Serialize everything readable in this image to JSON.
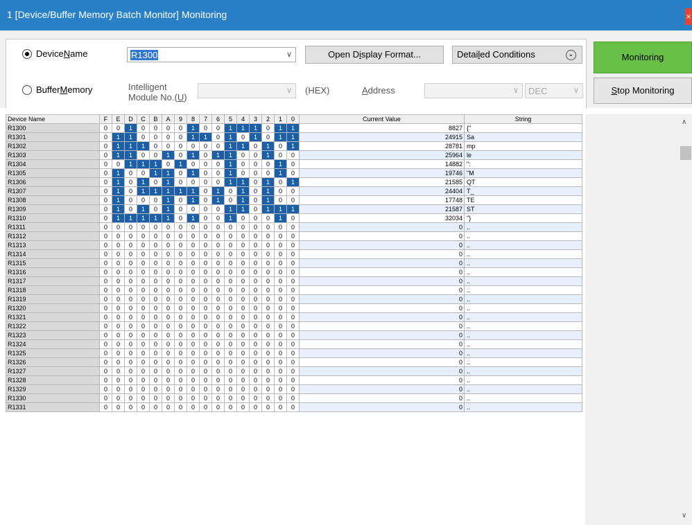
{
  "window": {
    "title": "1 [Device/Buffer Memory Batch Monitor] Monitoring",
    "close_glyph": "×"
  },
  "device": {
    "radio_label_pre": "Device ",
    "radio_label_key": "N",
    "radio_label_post": "ame",
    "value": "R1300",
    "dropdown_glyph": "∨"
  },
  "buffer": {
    "radio_label_pre": "Buffer ",
    "radio_label_key": "M",
    "radio_label_post": "emory",
    "module_label_line1": "Intelligent",
    "module_label_line2_pre": "Module No.(",
    "module_label_line2_key": "U",
    "module_label_line2_post": ")",
    "hex_label": "(HEX)",
    "address_label_key": "A",
    "address_label_post": "ddress",
    "dec_label": "DEC"
  },
  "buttons": {
    "open_display_pre": "Open D",
    "open_display_key": "i",
    "open_display_post": "splay Format...",
    "detailed_pre": "Detai",
    "detailed_key": "l",
    "detailed_post": "ed Conditions",
    "detailed_glyph": "⌄",
    "monitoring": "Monitoring",
    "stop_key": "S",
    "stop_post": "top Monitoring"
  },
  "colors": {
    "title_bar": "#2a80c6",
    "monitoring_button": "#69c049",
    "bit_on": "#1b5fa8"
  },
  "table": {
    "headers": {
      "device": "Device Name",
      "bits": [
        "F",
        "E",
        "D",
        "C",
        "B",
        "A",
        "9",
        "8",
        "7",
        "6",
        "5",
        "4",
        "3",
        "2",
        "1",
        "0"
      ],
      "value": "Current Value",
      "string": "String"
    },
    "rows": [
      {
        "device": "R1300",
        "bits": "0010000100111011",
        "value": "8827",
        "string": "{\""
      },
      {
        "device": "R1301",
        "bits": "0110000110101011",
        "value": "24915",
        "string": "Sa"
      },
      {
        "device": "R1302",
        "bits": "0111000000110101",
        "value": "28781",
        "string": "mp"
      },
      {
        "device": "R1303",
        "bits": "0110010101100100",
        "value": "25964",
        "string": "le"
      },
      {
        "device": "R1304",
        "bits": "0011101000100010",
        "value": "14882",
        "string": "\":"
      },
      {
        "device": "R1305",
        "bits": "0100110100100010",
        "value": "19746",
        "string": "\"M"
      },
      {
        "device": "R1306",
        "bits": "0101010000110101",
        "value": "21585",
        "string": "QT"
      },
      {
        "device": "R1307",
        "bits": "0101111101010100",
        "value": "24404",
        "string": "T_"
      },
      {
        "device": "R1308",
        "bits": "0100010101010100",
        "value": "17748",
        "string": "TE"
      },
      {
        "device": "R1309",
        "bits": "0101010000110111",
        "value": "21587",
        "string": "ST"
      },
      {
        "device": "R1310",
        "bits": "0111110100100010",
        "value": "32034",
        "string": "\"}"
      },
      {
        "device": "R1311",
        "bits": "0000000000000000",
        "value": "0",
        "string": ".."
      },
      {
        "device": "R1312",
        "bits": "0000000000000000",
        "value": "0",
        "string": ".."
      },
      {
        "device": "R1313",
        "bits": "0000000000000000",
        "value": "0",
        "string": ".."
      },
      {
        "device": "R1314",
        "bits": "0000000000000000",
        "value": "0",
        "string": ".."
      },
      {
        "device": "R1315",
        "bits": "0000000000000000",
        "value": "0",
        "string": ".."
      },
      {
        "device": "R1316",
        "bits": "0000000000000000",
        "value": "0",
        "string": ".."
      },
      {
        "device": "R1317",
        "bits": "0000000000000000",
        "value": "0",
        "string": ".."
      },
      {
        "device": "R1318",
        "bits": "0000000000000000",
        "value": "0",
        "string": ".."
      },
      {
        "device": "R1319",
        "bits": "0000000000000000",
        "value": "0",
        "string": ".."
      },
      {
        "device": "R1320",
        "bits": "0000000000000000",
        "value": "0",
        "string": ".."
      },
      {
        "device": "R1321",
        "bits": "0000000000000000",
        "value": "0",
        "string": ".."
      },
      {
        "device": "R1322",
        "bits": "0000000000000000",
        "value": "0",
        "string": ".."
      },
      {
        "device": "R1323",
        "bits": "0000000000000000",
        "value": "0",
        "string": ".."
      },
      {
        "device": "R1324",
        "bits": "0000000000000000",
        "value": "0",
        "string": ".."
      },
      {
        "device": "R1325",
        "bits": "0000000000000000",
        "value": "0",
        "string": ".."
      },
      {
        "device": "R1326",
        "bits": "0000000000000000",
        "value": "0",
        "string": ".."
      },
      {
        "device": "R1327",
        "bits": "0000000000000000",
        "value": "0",
        "string": ".."
      },
      {
        "device": "R1328",
        "bits": "0000000000000000",
        "value": "0",
        "string": ".."
      },
      {
        "device": "R1329",
        "bits": "0000000000000000",
        "value": "0",
        "string": ".."
      },
      {
        "device": "R1330",
        "bits": "0000000000000000",
        "value": "0",
        "string": ".."
      },
      {
        "device": "R1331",
        "bits": "0000000000000000",
        "value": "0",
        "string": ".."
      }
    ]
  },
  "scrollbar": {
    "up_glyph": "∧",
    "down_glyph": "∨"
  }
}
